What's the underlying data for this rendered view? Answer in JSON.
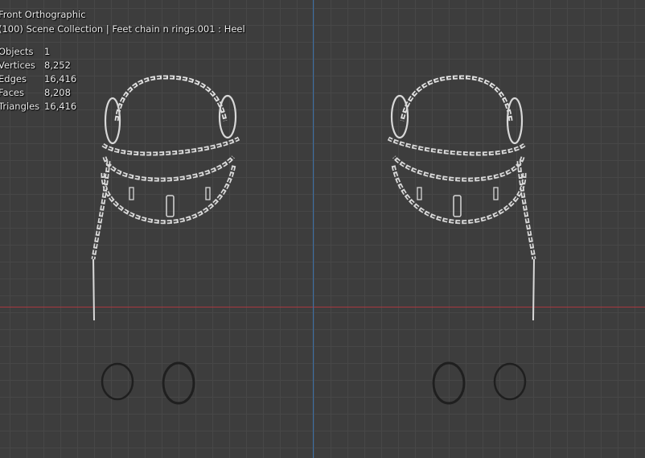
{
  "viewport": {
    "view_name": "Front Orthographic",
    "collection_info": "(100) Scene Collection | Feet chain n rings.001 : Heel"
  },
  "stats": [
    {
      "label": "Objects",
      "value": "1"
    },
    {
      "label": "Vertices",
      "value": "8,252"
    },
    {
      "label": "Edges",
      "value": "16,416"
    },
    {
      "label": "Faces",
      "value": "8,208"
    },
    {
      "label": "Triangles",
      "value": "16,416"
    }
  ],
  "colors": {
    "background": "#3d3d3d",
    "grid": "#474747",
    "x_axis": "#a8373f",
    "z_axis": "#3a6fa8",
    "wireframe": "#d8d8d8"
  }
}
